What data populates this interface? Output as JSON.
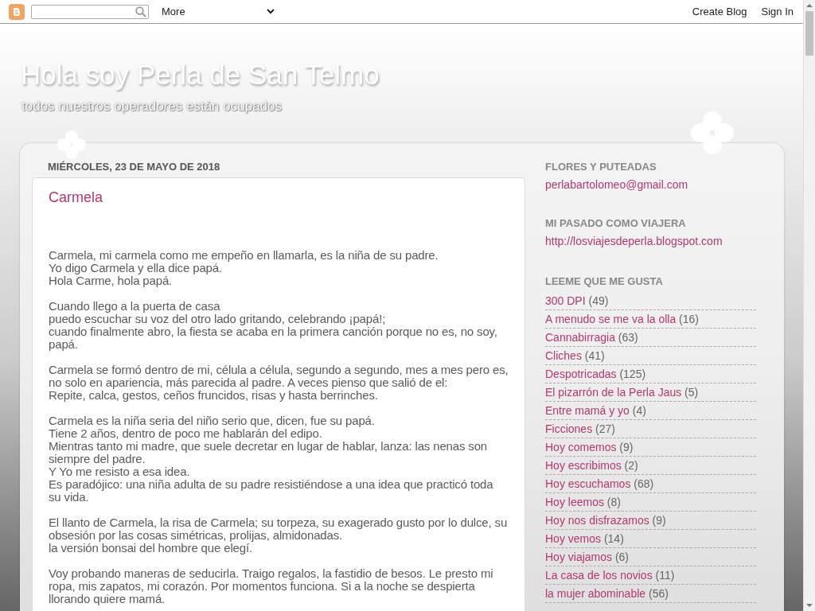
{
  "navbar": {
    "menu": "More",
    "links": [
      "Create Blog",
      "Sign In"
    ]
  },
  "header": {
    "title": "Hola soy Perla de San Telmo",
    "description": "todos nuestros operadores están ocupados"
  },
  "post": {
    "date": "MIÉRCOLES, 23 DE MAYO DE 2018",
    "title": "Carmela",
    "paragraphs": [
      {
        "lines": [
          "Carmela, mi carmela como me empeño en llamarla, es la niña de su padre.",
          "Yo digo Carmela y ella dice papá.",
          "Hola Carme, hola papá."
        ]
      },
      {
        "lines": [
          "Cuando llego a la puerta de casa",
          "puedo escuchar su voz del otro lado gritando, celebrando ¡papá!;",
          "cuando finalmente abro, la fiesta se acaba en la primera canción porque no es, no soy, papá."
        ]
      },
      {
        "lines": [
          "Carmela se formó dentro de mi, célula a célula, segundo a segundo, mes a mes pero es, no solo en apariencia, más parecida al padre. A veces pienso que salió de el:",
          "Repite, calca, gestos, ceños fruncidos, risas y hasta berrinches."
        ]
      },
      {
        "lines": [
          "Carmela es la niña seria del niño serio que, dicen, fue su papá.",
          "Tiene 2 años, dentro de poco me hablarán del edipo.",
          "Mientras tanto mi madre, que suele decretar en lugar de hablar, lanza: las nenas son siempre del padre.",
          "Y Yo me resisto a esa idea.",
          "Es paradójico: una niña adulta de su padre resistiéndose a una idea que practicó toda su vida."
        ]
      },
      {
        "lines": [
          "El llanto de Carmela, la risa de Carmela; su torpeza, su exagerado gusto por lo dulce, su obsesión por las cosas simétricas, prolijas, almidonadas.",
          "la versión bonsai del hombre que elegí."
        ]
      },
      {
        "lines": [
          "Voy probando maneras de seducirla. Traigo regalos, la fastidio de besos. Le presto mi ropa, mis zapatos, mi corazón. Por momentos funciona. Si a la noche se despierta llorando quiere mamá."
        ]
      }
    ]
  },
  "sidebar": {
    "widgets": [
      {
        "kind": "link",
        "title": "FLORES Y PUTEADAS",
        "link": "perlabartolomeo@gmail.com"
      },
      {
        "kind": "link",
        "title": "MI PASADO COMO VIAJERA",
        "link": "http://losviajesdeperla.blogspot.com"
      },
      {
        "kind": "labels",
        "title": "LEEME QUE ME GUSTA",
        "items": [
          {
            "label": "300 DPI",
            "count": "(49)"
          },
          {
            "label": "A menudo se me va la olla",
            "count": "(16)"
          },
          {
            "label": "Cannabirragia",
            "count": "(63)"
          },
          {
            "label": "Cliches",
            "count": "(41)"
          },
          {
            "label": "Despotricadas",
            "count": "(125)"
          },
          {
            "label": "El pizarrón de la Perla Jaus",
            "count": "(5)"
          },
          {
            "label": "Entre mamá y yo",
            "count": "(4)"
          },
          {
            "label": "Ficciones",
            "count": "(27)"
          },
          {
            "label": "Hoy comemos",
            "count": "(9)"
          },
          {
            "label": "Hoy escribimos",
            "count": "(2)"
          },
          {
            "label": "Hoy escuchamos",
            "count": "(68)"
          },
          {
            "label": "Hoy leemos",
            "count": "(8)"
          },
          {
            "label": "Hoy nos disfrazamos",
            "count": "(9)"
          },
          {
            "label": "Hoy vemos",
            "count": "(14)"
          },
          {
            "label": "Hoy viajamos",
            "count": "(6)"
          },
          {
            "label": "La casa de los novios",
            "count": "(11)"
          },
          {
            "label": "la mujer abominable",
            "count": "(56)"
          }
        ]
      }
    ]
  }
}
